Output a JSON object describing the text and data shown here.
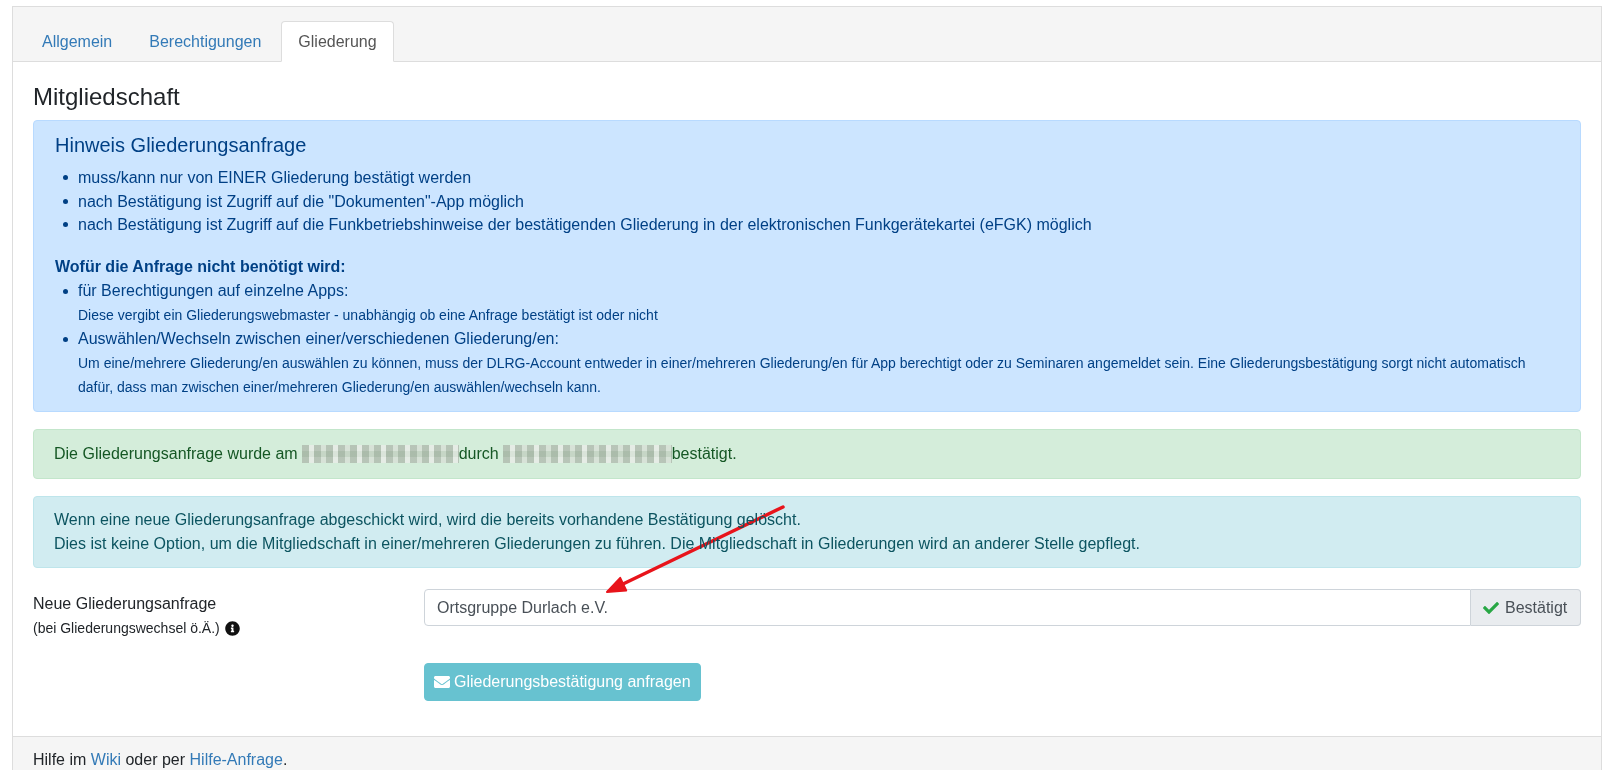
{
  "tabs": [
    {
      "label": "Allgemein",
      "selected": false
    },
    {
      "label": "Berechtigungen",
      "selected": false
    },
    {
      "label": "Gliederung",
      "selected": true
    }
  ],
  "heading": "Mitgliedschaft",
  "notice": {
    "title": "Hinweis Gliederungsanfrage",
    "items": [
      "muss/kann nur von EINER Gliederung bestätigt werden",
      "nach Bestätigung ist Zugriff auf die \"Dokumenten\"-App möglich",
      "nach Bestätigung ist Zugriff auf die Funkbetriebshinweise der bestätigenden Gliederung in der elektronischen Funkgerätekartei (eFGK) möglich"
    ],
    "subheading": "Wofür die Anfrage nicht benötigt wird:",
    "cases": [
      {
        "label": "für Berechtigungen auf einzelne Apps:",
        "detail": "Diese vergibt ein Gliederungswebmaster - unabhängig ob eine Anfrage bestätigt ist oder nicht"
      },
      {
        "label": "Auswählen/Wechseln zwischen einer/verschiedenen Gliederung/en:",
        "detail": "Um eine/mehrere Gliederung/en auswählen zu können, muss der DLRG-Account entweder in einer/mehreren Gliederung/en für App berechtigt oder zu Seminaren angemeldet sein. Eine Gliederungsbestätigung sorgt nicht automatisch dafür, dass man zwischen einer/mehreren Gliederung/en auswählen/wechseln kann."
      }
    ]
  },
  "confirmation": {
    "parts": [
      {
        "kind": "text",
        "text": "Die Gliederungsanfrage wurde am"
      },
      {
        "kind": "redacted"
      },
      {
        "kind": "text",
        "text": "durch"
      },
      {
        "kind": "redacted"
      },
      {
        "kind": "text",
        "text": "bestätigt."
      }
    ]
  },
  "warning": {
    "lines": [
      "Wenn eine neue Gliederungsanfrage abgeschickt wird, wird die bereits vorhandene Bestätigung gelöscht.",
      "Dies ist keine Option, um die Mitgliedschaft in einer/mehreren Gliederungen zu führen. Die Mitgliedschaft in Gliederungen wird an anderer Stelle gepflegt."
    ]
  },
  "form": {
    "label": "Neue Gliederungsanfrage",
    "hint": "(bei Gliederungswechsel ö.Ä.)",
    "value": "Ortsgruppe Durlach e.V.",
    "status": "Bestätigt",
    "button": {
      "label": "Gliederungsbestätigung anfragen",
      "disabled": true
    }
  },
  "footer": {
    "text_before": "Hilfe im",
    "wiki_link": "Wiki",
    "text_middle": "oder per",
    "help_link": "Hilfe-Anfrage",
    "text_after": "."
  }
}
